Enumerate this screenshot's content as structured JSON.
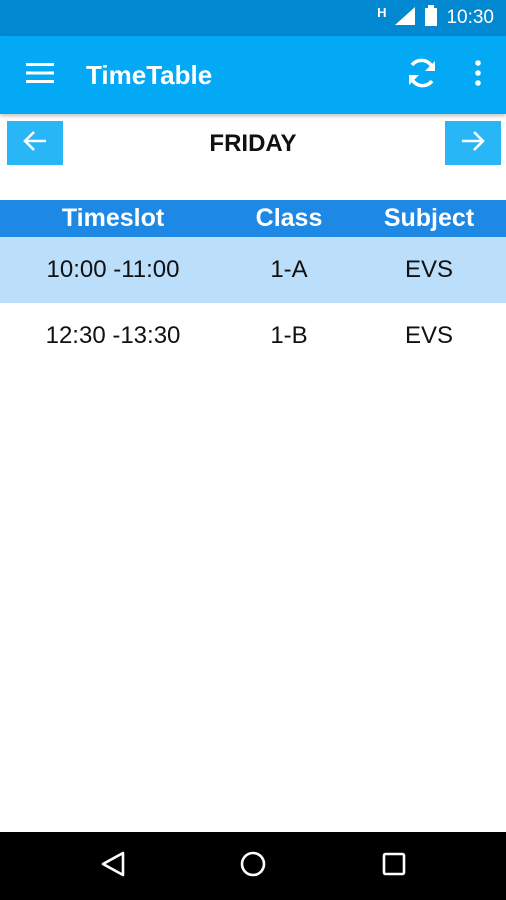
{
  "status_bar": {
    "network": "H",
    "time": "10:30"
  },
  "app_bar": {
    "title": "TimeTable",
    "menu_icon": "hamburger-menu-icon",
    "refresh_icon": "refresh-icon",
    "more_icon": "more-vert-icon"
  },
  "day_nav": {
    "day": "FRIDAY",
    "prev_icon": "arrow-left-icon",
    "next_icon": "arrow-right-icon"
  },
  "table": {
    "headers": [
      "Timeslot",
      "Class",
      "Subject"
    ],
    "rows": [
      {
        "timeslot": "10:00 -11:00",
        "class": "1-A",
        "subject": "EVS"
      },
      {
        "timeslot": "12:30 -13:30",
        "class": "1-B",
        "subject": "EVS"
      }
    ]
  },
  "colors": {
    "status_bar": "#0288d1",
    "app_bar": "#03a9f4",
    "nav_button": "#29b6f6",
    "table_header": "#1e88e5",
    "highlight_row": "#bbdefb"
  },
  "system_nav": {
    "back_icon": "back-triangle-icon",
    "home_icon": "home-circle-icon",
    "recents_icon": "recents-square-icon"
  }
}
